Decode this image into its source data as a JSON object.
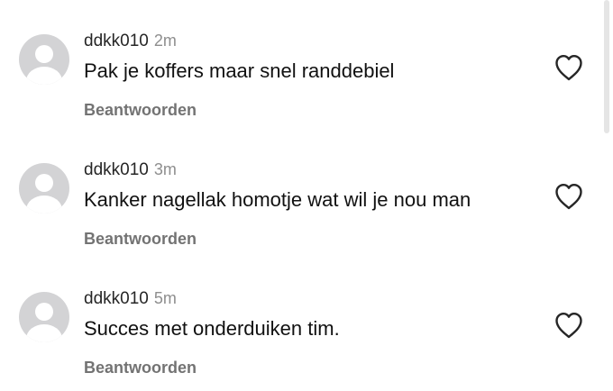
{
  "comments": [
    {
      "username": "ddkk010",
      "time": "2m",
      "text": "Pak je koffers maar snel randdebiel",
      "reply_label": "Beantwoorden"
    },
    {
      "username": "ddkk010",
      "time": "3m",
      "text": "Kanker nagellak homotje wat wil je nou man",
      "reply_label": "Beantwoorden"
    },
    {
      "username": "ddkk010",
      "time": "5m",
      "text": "Succes met onderduiken tim.",
      "reply_label": "Beantwoorden"
    }
  ],
  "icons": {
    "avatar": "default-avatar-icon",
    "like": "heart-outline-icon"
  },
  "colors": {
    "avatar_bg": "#d3d3d5",
    "avatar_fg": "#ffffff",
    "username": "#262626",
    "time": "#8e8e8e",
    "reply": "#737373",
    "heart_stroke": "#262626"
  }
}
